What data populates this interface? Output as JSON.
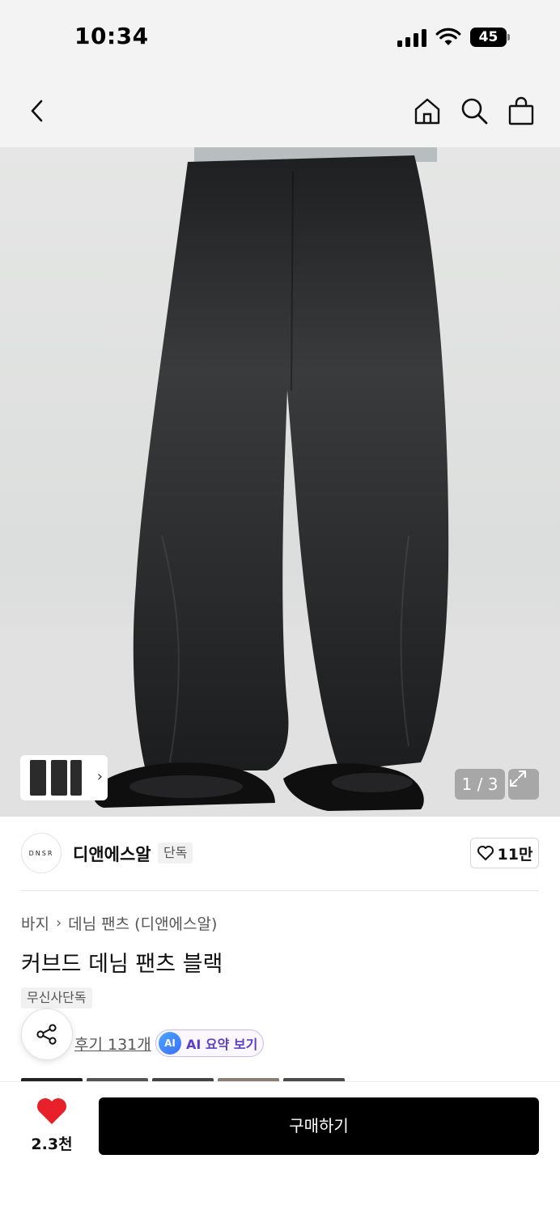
{
  "status_bar": {
    "time": "10:34",
    "battery": "45"
  },
  "nav": {
    "icons": [
      "back-icon",
      "home-icon",
      "search-icon",
      "shopping-bag-icon"
    ]
  },
  "gallery": {
    "counter": "1 / 3"
  },
  "brand": {
    "logo_text": "DNSR",
    "name": "디앤에스알",
    "tag": "단독",
    "likes": "11만"
  },
  "breadcrumb": {
    "category": "바지",
    "subcategory": "데님 팬츠 (디앤에스알)"
  },
  "product": {
    "title": "커브드 데님 팬츠 블랙",
    "exclusive_tag": "무신사단독"
  },
  "reviews": {
    "label": "후기 131개"
  },
  "ai_summary": {
    "badge": "AI",
    "label": "AI 요약 보기"
  },
  "bottom_bar": {
    "fav_count": "2.3천",
    "buy_label": "구매하기"
  },
  "colors": {
    "heart": "#e8202a",
    "ai_accent": "#5b3fc7",
    "buy_bg": "#000000"
  }
}
